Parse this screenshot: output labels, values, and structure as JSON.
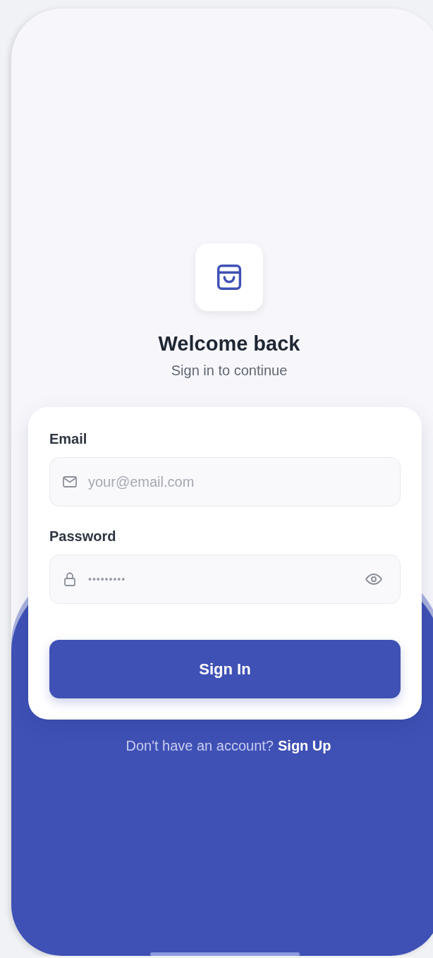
{
  "header": {
    "title": "Welcome back",
    "subtitle": "Sign in to continue"
  },
  "form": {
    "fields": [
      {
        "kind": "email",
        "label": "Email",
        "placeholder": "your@email.com"
      },
      {
        "kind": "password",
        "label": "Password",
        "value": "•••••••••"
      }
    ],
    "submit": "Sign In"
  },
  "footer": {
    "prompt": "Don't have an account?",
    "link": "Sign Up"
  }
}
